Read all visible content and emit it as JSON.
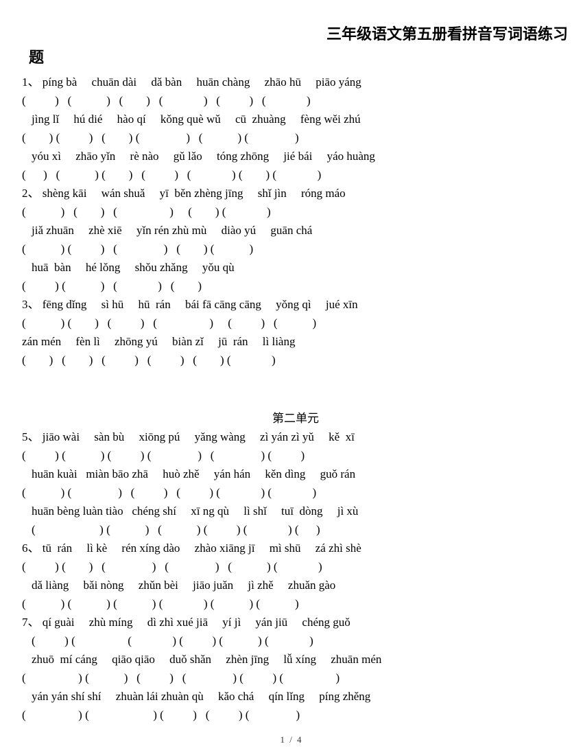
{
  "document": {
    "title_line1": "三年级语文第五册看拼音写词语练习",
    "title_tail": "题",
    "footer": "1 / 4"
  },
  "unit_heading": "第二单元",
  "exercises": [
    {
      "number": "1、",
      "lines": [
        {
          "type": "pinyin",
          "indent": false,
          "text": "1、 píng bà     chuān dài     dǎ bàn     huān chàng     zhāo hū     piāo yáng"
        },
        {
          "type": "parens",
          "indent": false,
          "text": "(          )   (            )   (        )   (              )   (          )   (              )"
        },
        {
          "type": "pinyin",
          "indent": true,
          "text": "jìng lǐ     hú dié     hào qí     kǒng què wǔ     cū  zhuàng     fèng wěi zhú"
        },
        {
          "type": "parens",
          "indent": false,
          "text": "(        ) (          )   (        ) (                )   (            ) (                )"
        },
        {
          "type": "pinyin",
          "indent": true,
          "text": "yóu xì     zhāo yǐn     rè nào     gǔ lǎo     tóng zhōng     jié bái     yáo huàng"
        },
        {
          "type": "parens",
          "indent": false,
          "text": "(      )   (            ) (        )   (          )   (              ) (        ) (              )"
        }
      ]
    },
    {
      "number": "2、",
      "lines": [
        {
          "type": "pinyin",
          "indent": false,
          "text": "2、 shèng kāi     wán shuǎ     yī  běn zhèng jīng     shǐ jìn     róng máo"
        },
        {
          "type": "parens",
          "indent": false,
          "text": "(            )   (        )   (                  )     (        ) (              )"
        },
        {
          "type": "pinyin",
          "indent": true,
          "text": "jiǎ zhuān     zhè xiē     yǐn rén zhù mù     diào yú     guān chá"
        },
        {
          "type": "parens",
          "indent": false,
          "text": "(            ) (          )   (                )   (        ) (            )"
        },
        {
          "type": "pinyin",
          "indent": true,
          "text": "huā  bàn     hé lǒng     shǒu zhǎng     yǒu qù"
        },
        {
          "type": "parens",
          "indent": false,
          "text": "(          ) (            )   (              )   (        )"
        }
      ]
    },
    {
      "number": "3、",
      "lines": [
        {
          "type": "pinyin",
          "indent": false,
          "text": "3、 fēng dǐng     sì hū     hū  rán     bái fā cāng cāng     yǒng qì     jué xīn"
        },
        {
          "type": "parens",
          "indent": false,
          "text": "(            ) (        )   (          )   (                  )     (          )   (            )"
        },
        {
          "type": "pinyin",
          "indent": false,
          "text": "zán mén     fèn lì     zhōng yú     biàn zǐ     jū  rán     lì liàng"
        },
        {
          "type": "parens",
          "indent": false,
          "text": "(        )   (        )   (          )   (          )   (        ) (              )"
        }
      ]
    },
    {
      "number": "5、",
      "lines": [
        {
          "type": "pinyin",
          "indent": false,
          "text": "5、 jiāo wài     sàn bù     xiōng pú     yǎng wàng     zì yán zì yǔ     kě  xī"
        },
        {
          "type": "parens",
          "indent": false,
          "text": "(          ) (            ) (          ) (                )   (                ) (          )"
        },
        {
          "type": "pinyin",
          "indent": true,
          "text": "huān kuài   miàn bāo zhā     huò zhě     yán hán     kěn dìng     guǒ rán"
        },
        {
          "type": "parens",
          "indent": false,
          "text": "(            ) (                )   (          )   (          ) (              ) (              )"
        },
        {
          "type": "pinyin",
          "indent": true,
          "text": "huān bèng luàn tiào   chéng shí     xī ng qù     lì shǐ     tuī  dòng     jì xù"
        },
        {
          "type": "parens",
          "indent": true,
          "text": "(                      ) (            )   (            ) (          ) (              ) (      )"
        }
      ]
    },
    {
      "number": "6、",
      "lines": [
        {
          "type": "pinyin",
          "indent": false,
          "text": "6、 tū  rán     lì kè     rén xíng dào     zhào xiāng jī     mì shū     zá zhì shè"
        },
        {
          "type": "parens",
          "indent": false,
          "text": "(          ) (        )   (                )   (                )   (            ) (              )"
        },
        {
          "type": "pinyin",
          "indent": true,
          "text": "dǎ liàng     bǎi nòng     zhǔn bèi     jiāo juǎn     jì zhě     zhuǎn gào"
        },
        {
          "type": "parens",
          "indent": false,
          "text": "(            ) (            ) (            ) (              ) (            ) (            )"
        }
      ]
    },
    {
      "number": "7、",
      "lines": [
        {
          "type": "pinyin",
          "indent": false,
          "text": "7、 qí guài     zhù míng     dì zhì xué jiā     yí jì     yán jiū     chéng guǒ"
        },
        {
          "type": "parens",
          "indent": true,
          "text": "(          ) (                  (              ) (          ) (            ) (              )"
        },
        {
          "type": "pinyin",
          "indent": true,
          "text": "zhuō  mí cáng     qiāo qiāo     duǒ shǎn     zhèn jīng     lǚ xíng     zhuān mén"
        },
        {
          "type": "parens",
          "indent": false,
          "text": "(                  ) (            )   (          )   (                ) (          ) (                  )"
        },
        {
          "type": "pinyin",
          "indent": true,
          "text": "yán yán shí shí     zhuàn lái zhuàn qù     kǎo chá     qín lǐng     píng zhěng"
        },
        {
          "type": "parens",
          "indent": false,
          "text": "(                  ) (                      ) (          )   (          ) (                )"
        }
      ]
    }
  ]
}
